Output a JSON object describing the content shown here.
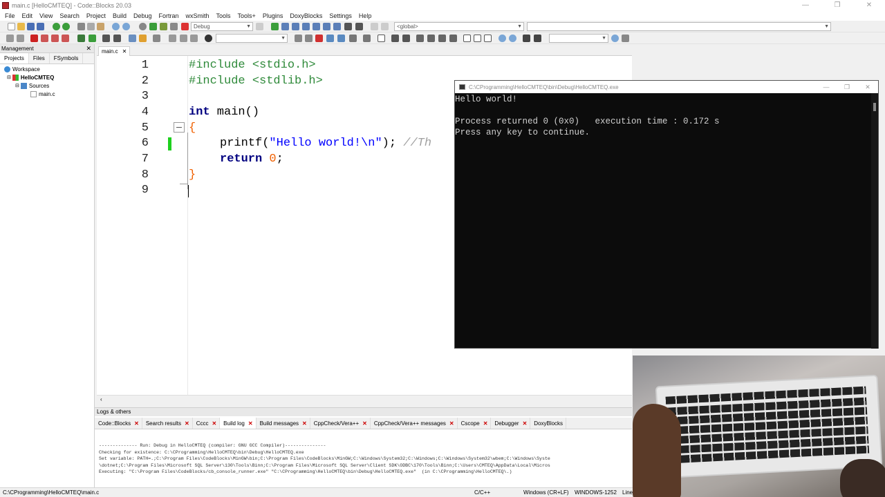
{
  "window": {
    "title": "main.c [HelloCMTEQ] - Code::Blocks 20.03",
    "controls": [
      "—",
      "❐",
      "✕"
    ]
  },
  "menu": [
    "File",
    "Edit",
    "View",
    "Search",
    "Project",
    "Build",
    "Debug",
    "Fortran",
    "wxSmith",
    "Tools",
    "Tools+",
    "Plugins",
    "DoxyBlocks",
    "Settings",
    "Help"
  ],
  "toolbar": {
    "build_target": "Debug",
    "scope": "<global>"
  },
  "management": {
    "title": "Management",
    "tabs": [
      "Projects",
      "Files",
      "FSymbols"
    ],
    "tree": {
      "workspace": "Workspace",
      "project": "HelloCMTEQ",
      "folder": "Sources",
      "file": "main.c"
    }
  },
  "editor": {
    "tab": "main.c",
    "line_numbers": [
      "1",
      "2",
      "3",
      "4",
      "5",
      "6",
      "7",
      "8",
      "9"
    ],
    "lines": {
      "l1": "#include <stdio.h>",
      "l2": "#include <stdlib.h>",
      "l4_kw": "int",
      "l4_rest": " main()",
      "l5": "{",
      "l6_call": "printf(",
      "l6_str": "\"Hello world!\\n\"",
      "l6_end": "); ",
      "l6_cmt": "//Th",
      "l7_kw": "return",
      "l7_num": "0",
      "l7_end": ";",
      "l8": "}"
    }
  },
  "console": {
    "title": "C:\\CProgramming\\HelloCMTEQ\\bin\\Debug\\HelloCMTEQ.exe",
    "line1": "Hello world!",
    "line2": "Process returned 0 (0x0)   execution time : 0.172 s",
    "line3": "Press any key to continue."
  },
  "logs": {
    "title": "Logs & others",
    "tabs": [
      "Code::Blocks",
      "Search results",
      "Cccc",
      "Build log",
      "Build messages",
      "CppCheck/Vera++",
      "CppCheck/Vera++ messages",
      "Cscope",
      "Debugger",
      "DoxyBlocks"
    ],
    "active_tab": "Build log",
    "text": {
      "l1": "-------------- Run: Debug in HelloCMTEQ (compiler: GNU GCC Compiler)---------------",
      "l2": "Checking for existence: C:\\CProgramming\\HelloCMTEQ\\bin\\Debug\\HelloCMTEQ.exe",
      "l3": "Set variable: PATH=.;C:\\Program Files\\CodeBlocks\\MinGW\\bin;C:\\Program Files\\CodeBlocks\\MinGW;C:\\Windows\\System32;C:\\Windows;C:\\Windows\\System32\\wbem;C:\\Windows\\Syste",
      "l4": "\\dotnet;C:\\Program Files\\Microsoft SQL Server\\130\\Tools\\Binn;C:\\Program Files\\Microsoft SQL Server\\Client SDK\\ODBC\\170\\Tools\\Binn;C:\\Users\\CMTEQ\\AppData\\Local\\Micros",
      "l5": "Executing: \"C:\\Program Files\\CodeBlocks/cb_console_runner.exe\" \"C:\\CProgramming\\HelloCMTEQ\\bin\\Debug\\HelloCMTEQ.exe\"  (in C:\\CProgramming\\HelloCMTEQ\\.)"
    }
  },
  "status": {
    "path": "C:\\CProgramming\\HelloCMTEQ\\main.c",
    "lang": "C/C++",
    "eol": "Windows (CR+LF)",
    "encoding": "WINDOWS-1252",
    "line": "Line"
  }
}
